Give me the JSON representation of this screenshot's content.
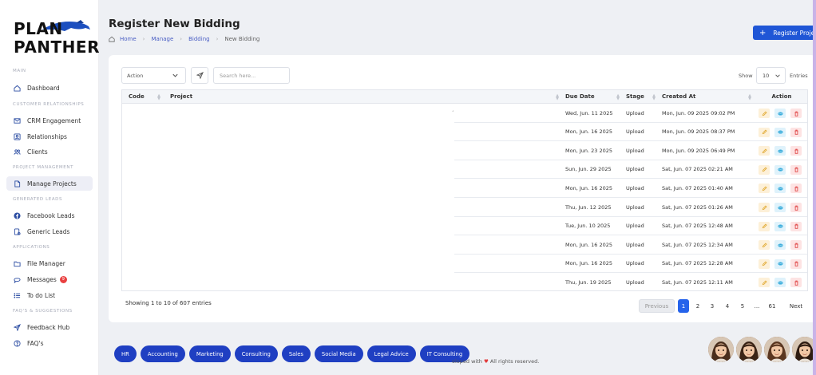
{
  "brand": {
    "line1": "PLAN",
    "line2": "PANTHER"
  },
  "sidebar": {
    "sections": [
      {
        "title": "MAIN"
      },
      {
        "title": "CUSTOMER RELATIONSHIPS"
      },
      {
        "title": "PROJECT MANAGEMENT"
      },
      {
        "title": "GENERATED LEADS"
      },
      {
        "title": "APPLICATIONS"
      },
      {
        "title": "FAQ'S & SUGGESTIONS"
      }
    ],
    "items": [
      {
        "label": "Dashboard",
        "icon": "home-icon"
      },
      {
        "label": "CRM Engagement",
        "icon": "mail-icon"
      },
      {
        "label": "Relationships",
        "icon": "contact-card-icon"
      },
      {
        "label": "Clients",
        "icon": "users-icon"
      },
      {
        "label": "Manage Projects",
        "icon": "document-icon",
        "active": true
      },
      {
        "label": "Facebook Leads",
        "icon": "facebook-icon"
      },
      {
        "label": "Generic Leads",
        "icon": "leads-icon"
      },
      {
        "label": "File Manager",
        "icon": "folder-icon"
      },
      {
        "label": "Messages",
        "icon": "chat-icon",
        "badge": "9"
      },
      {
        "label": "To do List",
        "icon": "list-icon"
      },
      {
        "label": "Feedback Hub",
        "icon": "send-icon"
      },
      {
        "label": "FAQ's",
        "icon": "question-icon"
      }
    ]
  },
  "header": {
    "title": "Register New Bidding",
    "breadcrumb": [
      "Home",
      "Manage",
      "Bidding",
      "New Bidding"
    ],
    "register_button": "Register Project"
  },
  "toolbar": {
    "action_label": "Action",
    "search_placeholder": "Search here...",
    "show_label": "Show",
    "page_size": "10",
    "entries_label": "Entries"
  },
  "table": {
    "columns": [
      "Code",
      "Project",
      "Due Date",
      "Stage",
      "Created At",
      "Action"
    ],
    "rows": [
      {
        "due": "Wed, Jun. 11 2025",
        "stage": "Upload",
        "created": "Mon, Jun. 09 2025 09:02 PM"
      },
      {
        "due": "Mon, Jun. 16 2025",
        "stage": "Upload",
        "created": "Mon, Jun. 09 2025 08:37 PM"
      },
      {
        "due": "Mon, Jun. 23 2025",
        "stage": "Upload",
        "created": "Mon, Jun. 09 2025 06:49 PM"
      },
      {
        "due": "Sun, Jun. 29 2025",
        "stage": "Upload",
        "created": "Sat, Jun. 07 2025 02:21 AM"
      },
      {
        "due": "Mon, Jun. 16 2025",
        "stage": "Upload",
        "created": "Sat, Jun. 07 2025 01:40 AM"
      },
      {
        "due": "Thu, Jun. 12 2025",
        "stage": "Upload",
        "created": "Sat, Jun. 07 2025 01:26 AM"
      },
      {
        "due": "Tue, Jun. 10 2025",
        "stage": "Upload",
        "created": "Sat, Jun. 07 2025 12:48 AM"
      },
      {
        "due": "Mon, Jun. 16 2025",
        "stage": "Upload",
        "created": "Sat, Jun. 07 2025 12:34 AM"
      },
      {
        "due": "Mon, Jun. 16 2025",
        "stage": "Upload",
        "created": "Sat, Jun. 07 2025 12:28 AM"
      },
      {
        "due": "Thu, Jun. 19 2025",
        "stage": "Upload",
        "created": "Sat, Jun. 07 2025 12:11 AM"
      }
    ]
  },
  "pagination": {
    "showing": "Showing 1 to 10 of 607 entries",
    "previous": "Previous",
    "pages": [
      "1",
      "2",
      "3",
      "4",
      "5",
      "...",
      "61"
    ],
    "current": "1",
    "next": "Next"
  },
  "tags": [
    "HR",
    "Accounting",
    "Marketing",
    "Consulting",
    "Sales",
    "Social Media",
    "Legal Advice",
    "IT Consulting"
  ],
  "footer": {
    "text_before": "oloped with",
    "text_after": "All rights reserved."
  },
  "colors": {
    "primary": "#1f56d6",
    "tag": "#1f3fc2",
    "active_page": "#2563eb"
  }
}
